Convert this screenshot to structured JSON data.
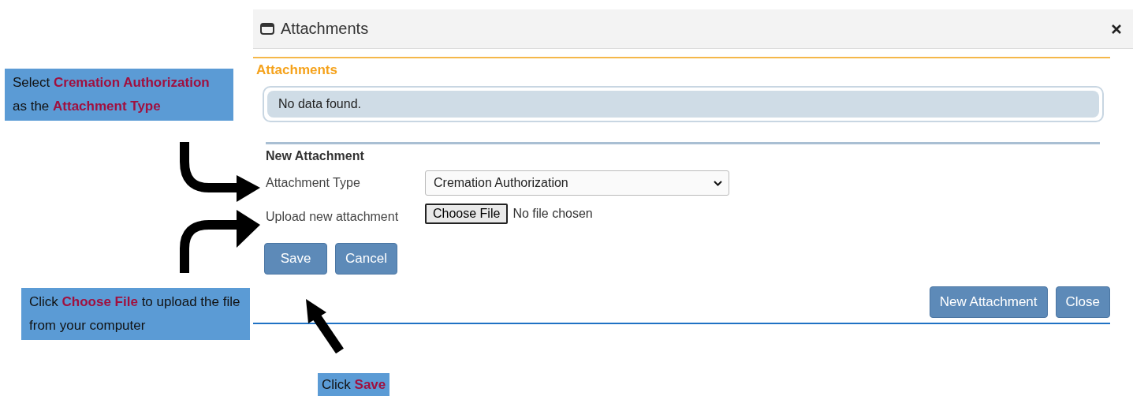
{
  "dialog": {
    "title": "Attachments",
    "section_title": "Attachments",
    "empty_message": "No data found.",
    "form": {
      "title": "New Attachment",
      "type_label": "Attachment Type",
      "type_value": "Cremation Authorization",
      "upload_label": "Upload new attachment",
      "choose_button": "Choose File",
      "file_status": "No file chosen"
    },
    "form_buttons": [
      "Save",
      "Cancel"
    ],
    "footer_buttons": [
      "New Attachment",
      "Close"
    ]
  },
  "callouts": [
    "Select **Cremation Authorization** as the **Attachment Type**",
    "Click **Choose File** to upload the file from your computer",
    "Click **Save**"
  ]
}
